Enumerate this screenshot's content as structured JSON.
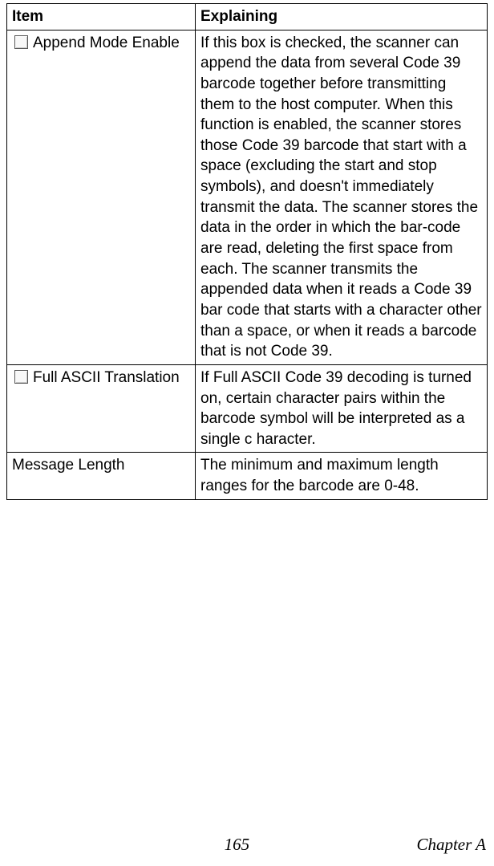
{
  "table": {
    "headers": {
      "item": "Item",
      "explaining": "Explaining"
    },
    "rows": [
      {
        "has_checkbox": true,
        "item": "Append Mode Enable",
        "explaining": "If this box is checked, the scanner can append the data from several Code 39 barcode together before transmitting them to the host computer. When this function is enabled, the scanner stores those Code 39 barcode that start with a space (excluding the start and stop symbols), and doesn't immediately transmit the data. The scanner stores the data in the order in which the bar-code are read, deleting the first space from each. The scanner transmits the appended data when it reads a Code 39 bar code that starts with a character other than a space, or when it reads a barcode that is not Code 39."
      },
      {
        "has_checkbox": true,
        "item": "Full ASCII Translation",
        "explaining": "If Full ASCII Code 39 decoding is turned on, certain character pairs within the barcode symbol will be interpreted as a single c haracter."
      },
      {
        "has_checkbox": false,
        "item": "Message Length",
        "explaining": "The minimum and maximum length ranges for the barcode are 0-48."
      }
    ]
  },
  "footer": {
    "page_number": "165",
    "chapter": "Chapter A"
  }
}
